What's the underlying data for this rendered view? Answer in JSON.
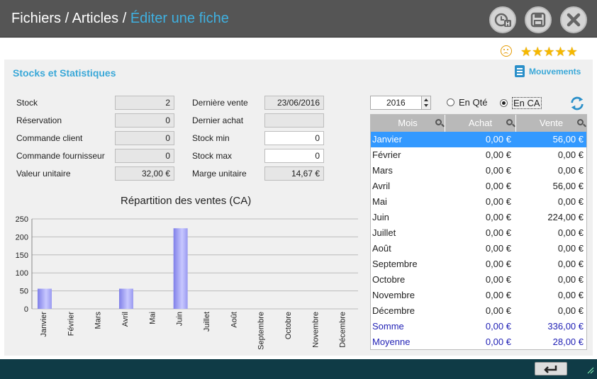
{
  "breadcrumb": {
    "part1": "Fichiers",
    "sep": " / ",
    "part2": "Articles",
    "active": "Éditer une fiche"
  },
  "toolbar": {
    "history_icon": "clock-h-icon",
    "save_icon": "floppy-icon",
    "close_icon": "close-icon"
  },
  "rating": {
    "smiley": "sad-face-icon",
    "stars": 5
  },
  "section": {
    "title": "Stocks et Statistiques",
    "mouvements_label": "Mouvements"
  },
  "fields": {
    "stock": {
      "label": "Stock",
      "value": "2"
    },
    "reservation": {
      "label": "Réservation",
      "value": "0"
    },
    "commande_client": {
      "label": "Commande client",
      "value": "0"
    },
    "commande_fournisseur": {
      "label": "Commande fournisseur",
      "value": "0"
    },
    "valeur_unitaire": {
      "label": "Valeur unitaire",
      "value": "32,00 €"
    },
    "derniere_vente": {
      "label": "Dernière vente",
      "value": "23/06/2016"
    },
    "dernier_achat": {
      "label": "Dernier achat",
      "value": ""
    },
    "stock_min": {
      "label": "Stock min",
      "value": "0"
    },
    "stock_max": {
      "label": "Stock max",
      "value": "0"
    },
    "marge_unitaire": {
      "label": "Marge unitaire",
      "value": "14,67 €"
    }
  },
  "chart_data": {
    "type": "bar",
    "title": "Répartition des ventes (CA)",
    "categories": [
      "Janvier",
      "Février",
      "Mars",
      "Avril",
      "Mai",
      "Juin",
      "Juillet",
      "Août",
      "Septembre",
      "Octobre",
      "Novembre",
      "Décembre"
    ],
    "values": [
      56,
      0,
      0,
      56,
      0,
      224,
      0,
      0,
      0,
      0,
      0,
      0
    ],
    "ylim": [
      0,
      250
    ],
    "yticks": [
      0,
      50,
      100,
      150,
      200,
      250
    ],
    "grid": true,
    "legend": "none",
    "bar_color": "#a8a8f0"
  },
  "controls": {
    "year": "2016",
    "radio_qte": "En Qté",
    "radio_ca": "En CA",
    "selected": "En CA"
  },
  "table": {
    "headers": {
      "mois": "Mois",
      "achat": "Achat",
      "vente": "Vente"
    },
    "rows": [
      {
        "mois": "Janvier",
        "achat": "0,00 €",
        "vente": "56,00 €"
      },
      {
        "mois": "Février",
        "achat": "0,00 €",
        "vente": "0,00 €"
      },
      {
        "mois": "Mars",
        "achat": "0,00 €",
        "vente": "0,00 €"
      },
      {
        "mois": "Avril",
        "achat": "0,00 €",
        "vente": "56,00 €"
      },
      {
        "mois": "Mai",
        "achat": "0,00 €",
        "vente": "0,00 €"
      },
      {
        "mois": "Juin",
        "achat": "0,00 €",
        "vente": "224,00 €"
      },
      {
        "mois": "Juillet",
        "achat": "0,00 €",
        "vente": "0,00 €"
      },
      {
        "mois": "Août",
        "achat": "0,00 €",
        "vente": "0,00 €"
      },
      {
        "mois": "Septembre",
        "achat": "0,00 €",
        "vente": "0,00 €"
      },
      {
        "mois": "Octobre",
        "achat": "0,00 €",
        "vente": "0,00 €"
      },
      {
        "mois": "Novembre",
        "achat": "0,00 €",
        "vente": "0,00 €"
      },
      {
        "mois": "Décembre",
        "achat": "0,00 €",
        "vente": "0,00 €"
      }
    ],
    "totals": [
      {
        "mois": "Somme",
        "achat": "0,00 €",
        "vente": "336,00 €"
      },
      {
        "mois": "Moyenne",
        "achat": "0,00 €",
        "vente": "28,00 €"
      }
    ]
  },
  "footer": {
    "back_icon": "return-arrow-icon"
  }
}
